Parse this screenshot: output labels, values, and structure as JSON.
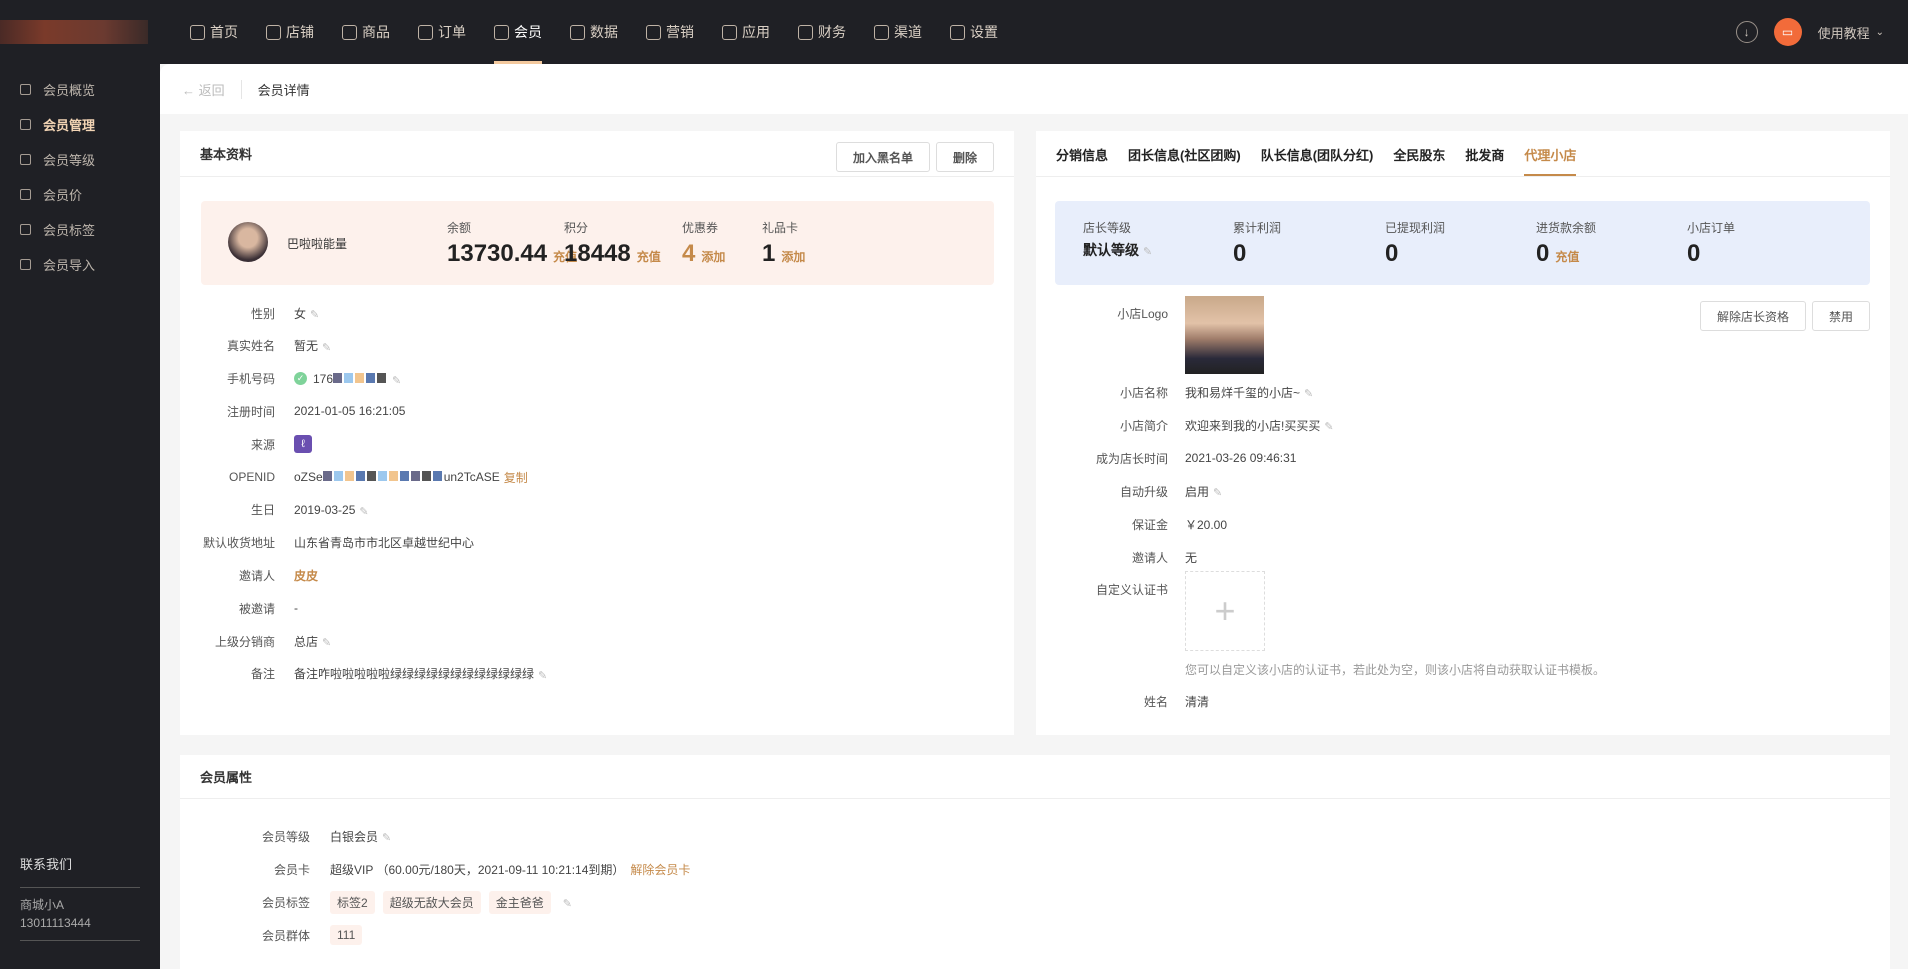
{
  "nav": {
    "items": [
      {
        "label": "首页",
        "icon": "home-icon"
      },
      {
        "label": "店铺",
        "icon": "shop-icon"
      },
      {
        "label": "商品",
        "icon": "goods-icon"
      },
      {
        "label": "订单",
        "icon": "order-icon"
      },
      {
        "label": "会员",
        "icon": "user-icon",
        "active": true
      },
      {
        "label": "数据",
        "icon": "chart-icon"
      },
      {
        "label": "营销",
        "icon": "tag-icon"
      },
      {
        "label": "应用",
        "icon": "app-icon"
      },
      {
        "label": "财务",
        "icon": "finance-icon"
      },
      {
        "label": "渠道",
        "icon": "channel-icon"
      },
      {
        "label": "设置",
        "icon": "gear-icon"
      }
    ],
    "tutorial": "使用教程"
  },
  "sidebar": {
    "items": [
      {
        "label": "会员概览"
      },
      {
        "label": "会员管理",
        "active": true
      },
      {
        "label": "会员等级"
      },
      {
        "label": "会员价"
      },
      {
        "label": "会员标签"
      },
      {
        "label": "会员导入"
      }
    ],
    "contact_title": "联系我们",
    "contact_name": "商城小A",
    "contact_phone": "13011113444"
  },
  "breadcrumb": {
    "back": "返回",
    "current": "会员详情"
  },
  "basic": {
    "title": "基本资料",
    "blacklist": "加入黑名单",
    "delete": "删除",
    "name": "巴啦啦能量",
    "stats": [
      {
        "label": "余额",
        "value": "13730.44",
        "action": "充值"
      },
      {
        "label": "积分",
        "value": "18448",
        "action": "充值"
      },
      {
        "label": "优惠券",
        "value": "4",
        "action": "添加"
      },
      {
        "label": "礼品卡",
        "value": "1",
        "action": "添加"
      }
    ],
    "rows": [
      {
        "label": "性别",
        "value": "女"
      },
      {
        "label": "真实姓名",
        "value": "暂无"
      },
      {
        "label": "手机号码",
        "value": "176"
      },
      {
        "label": "注册时间",
        "value": "2021-01-05 16:21:05"
      },
      {
        "label": "来源",
        "value": ""
      },
      {
        "label": "OPENID",
        "value": "oZSe",
        "value_tail": "un2TcASE",
        "copy": "复制"
      },
      {
        "label": "生日",
        "value": "2019-03-25"
      },
      {
        "label": "默认收货地址",
        "value": "山东省青岛市市北区卓越世纪中心"
      },
      {
        "label": "邀请人",
        "value": "皮皮"
      },
      {
        "label": "被邀请",
        "value": "-"
      },
      {
        "label": "上级分销商",
        "value": "总店"
      },
      {
        "label": "备注",
        "value": "备注咋啦啦啦啦啦绿绿绿绿绿绿绿绿绿绿绿绿"
      }
    ]
  },
  "shop": {
    "tabs": [
      "分销信息",
      "团长信息(社区团购)",
      "队长信息(团队分红)",
      "全民股东",
      "批发商",
      "代理小店"
    ],
    "stats": [
      {
        "label": "店长等级",
        "value": "默认等级"
      },
      {
        "label": "累计利润",
        "value": "0"
      },
      {
        "label": "已提现利润",
        "value": "0"
      },
      {
        "label": "进货款余额",
        "value": "0",
        "action": "充值"
      },
      {
        "label": "小店订单",
        "value": "0"
      }
    ],
    "remove": "解除店长资格",
    "disable": "禁用",
    "logo_label": "小店Logo",
    "rows": [
      {
        "label": "小店名称",
        "value": "我和易烊千玺的小店~"
      },
      {
        "label": "小店简介",
        "value": "欢迎来到我的小店!买买买"
      },
      {
        "label": "成为店长时间",
        "value": "2021-03-26 09:46:31"
      },
      {
        "label": "自动升级",
        "value": "启用"
      },
      {
        "label": "保证金",
        "value": "￥20.00"
      },
      {
        "label": "邀请人",
        "value": "无"
      }
    ],
    "cert_label": "自定义认证书",
    "cert_hint": "您可以自定义该小店的认证书，若此处为空，则该小店将自动获取认证书模板。",
    "name_label": "姓名",
    "name_value": "清清"
  },
  "attr": {
    "title": "会员属性",
    "level_label": "会员等级",
    "level": "白银会员",
    "card_label": "会员卡",
    "card": "超级VIP （60.00元/180天，2021-09-11 10:21:14到期）",
    "card_action": "解除会员卡",
    "tags_label": "会员标签",
    "tags": [
      "标签2",
      "超级无敌大会员",
      "金主爸爸"
    ],
    "group_label": "会员群体",
    "groups": [
      "111"
    ]
  },
  "colors": {
    "accent": "#c58a4a",
    "nav_bg": "#1f2025"
  }
}
